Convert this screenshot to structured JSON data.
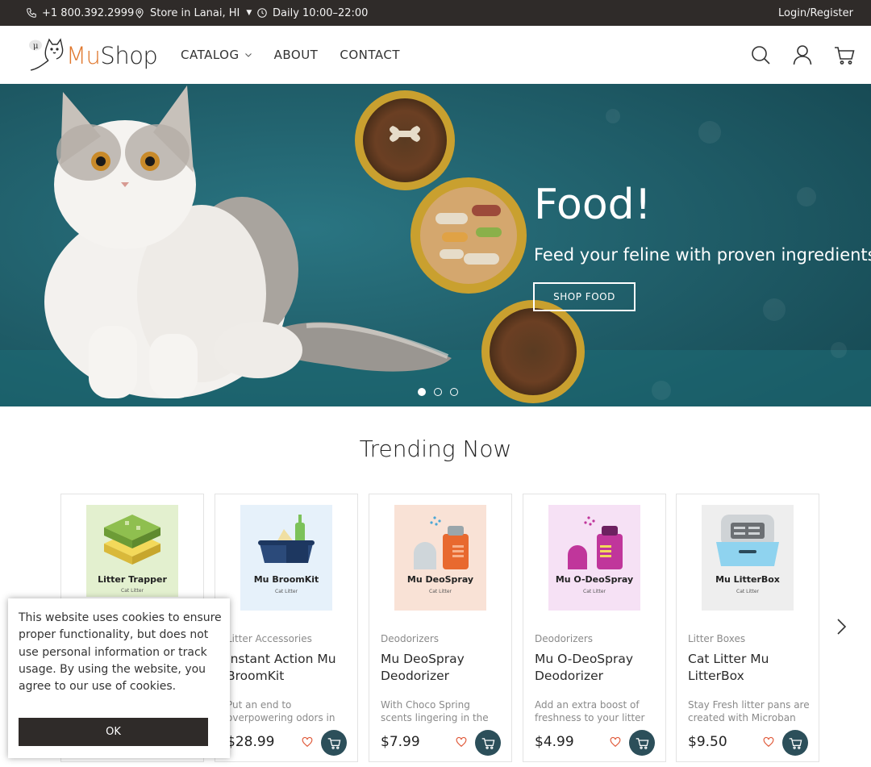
{
  "topbar": {
    "phone": "+1 800.392.2999",
    "store": "Store in Lanai, HI",
    "hours": "Daily 10:00–22:00",
    "login": "Login/Register"
  },
  "header": {
    "logo_mu": "Mu",
    "logo_shop": "Shop",
    "nav": [
      "CATALOG",
      "ABOUT",
      "CONTACT"
    ]
  },
  "hero": {
    "title": "Food!",
    "subtitle": "Feed your feline with proven ingredients",
    "button": "SHOP FOOD",
    "active_slide": 1,
    "slide_count": 3
  },
  "trending": {
    "title": "Trending Now",
    "products": [
      {
        "thumb_name": "Litter Trapper",
        "thumb_sub": "Cat Litter",
        "category": "",
        "name": "",
        "desc": "",
        "price": ""
      },
      {
        "thumb_name": "Mu BroomKit",
        "thumb_sub": "Cat Litter",
        "category": "Litter Accessories",
        "name": "Instant Action Mu BroomKit",
        "desc": "Put an end to overpowering odors in",
        "price": "$28.99"
      },
      {
        "thumb_name": "Mu DeoSpray",
        "thumb_sub": "Cat Litter",
        "category": "Deodorizers",
        "name": "Mu DeoSpray Deodorizer",
        "desc": "With Choco Spring scents lingering in the air, your",
        "price": "$7.99"
      },
      {
        "thumb_name": "Mu O-DeoSpray",
        "thumb_sub": "Cat Litter",
        "category": "Deodorizers",
        "name": "Mu O-DeoSpray Deodorizer",
        "desc": "Add an extra boost of freshness to your litter",
        "price": "$4.99"
      },
      {
        "thumb_name": "Mu LitterBox",
        "thumb_sub": "Cat Litter",
        "category": "Litter Boxes",
        "name": "Cat Litter Mu LitterBox",
        "desc": "Stay Fresh litter pans are created with Microban",
        "price": "$9.50"
      }
    ]
  },
  "cookie": {
    "text": "This website uses cookies to ensure proper functionality, but does not use personal information or track usage. By using the website, you agree to our use of cookies.",
    "button": "OK"
  },
  "colors": {
    "topbar": "#2f2b29",
    "accent": "#e0782e",
    "hero_bg": "#1e5c67",
    "cart_button": "#2c4f5a"
  },
  "icons": {
    "phone": "phone-icon",
    "store": "location-pin-icon",
    "hours": "clock-icon",
    "search": "search-icon",
    "account": "user-icon",
    "cart": "cart-icon",
    "wishlist": "heart-icon",
    "next": "chevron-right-icon"
  }
}
